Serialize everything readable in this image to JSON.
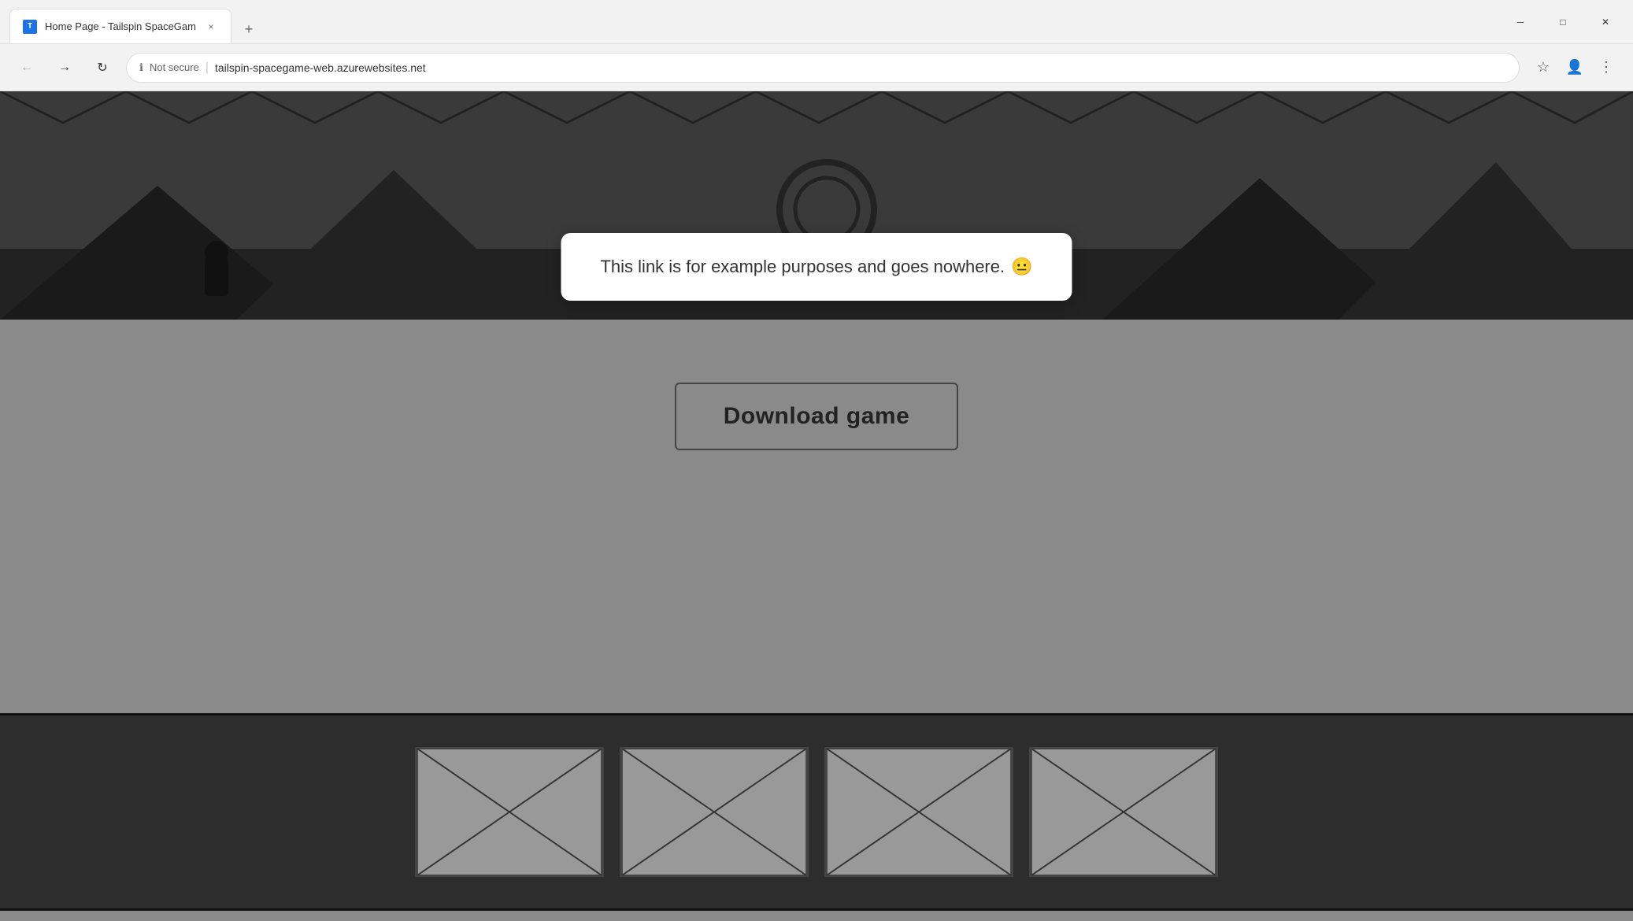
{
  "browser": {
    "tab": {
      "favicon": "T",
      "title": "Home Page - Tailspin SpaceGam",
      "close_label": "×"
    },
    "new_tab_label": "+",
    "window_controls": {
      "minimize_label": "─",
      "maximize_label": "□",
      "close_label": "✕"
    },
    "address_bar": {
      "back_label": "←",
      "forward_label": "→",
      "refresh_label": "↻",
      "security_icon": "ℹ",
      "security_text": "Not secure",
      "separator": "|",
      "url": "tailspin-spacegame-web.azurewebsites.net",
      "star_icon": "☆",
      "profile_icon": "👤",
      "menu_icon": "⋮"
    }
  },
  "webpage": {
    "tooltip": {
      "text": "This link is for example purposes and goes nowhere.",
      "emoji": "😐"
    },
    "download_button": {
      "label": "Download game"
    },
    "placeholder_images": [
      {
        "id": 1
      },
      {
        "id": 2
      },
      {
        "id": 3
      },
      {
        "id": 4
      }
    ]
  }
}
